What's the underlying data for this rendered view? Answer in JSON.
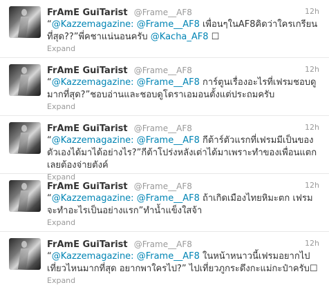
{
  "tweets": [
    {
      "fullname": "FrAmE GuiTarist",
      "username": "@Frame__AF8",
      "time": "12h",
      "q_open": "“",
      "mention": "@Kazzemagazine: @Frame__AF8",
      "body": " เพื่อนๆในAF8คิดว่าใครเกรียนที่สุด??”พี่คชาแน่นอนครับ ",
      "mention2": "@Kacha_AF8",
      "tail": " ☐",
      "expand": "Expand"
    },
    {
      "fullname": "FrAmE GuiTarist",
      "username": "@Frame__AF8",
      "time": "12h",
      "q_open": "“",
      "mention": "@Kazzemagazine: @Frame__AF8",
      "body": " การ์ตูนเรื่องอะไรที่เฟรมชอบดูมากที่สุด?”ชอบอ่านและชอบดูโดราเอมอนตั้งแต่ประถมครับ",
      "mention2": "",
      "tail": "",
      "expand": "Expand"
    },
    {
      "fullname": "FrAmE GuiTarist",
      "username": "@Frame__AF8",
      "time": "12h",
      "q_open": "“",
      "mention": "@Kazzemagazine: @Frame__AF8",
      "body": " กีต้าร์ตัวแรกที่เฟรมมีเป็นของตัวเองได้มาได้อย่างไร?”กีต้าโปร่งหลังเต่าได้มาเพราะทำของเพื่อนแตก เลยต้องจ่ายตังค์",
      "mention2": "",
      "tail": "",
      "expand": "Expand"
    },
    {
      "fullname": "FrAmE GuiTarist",
      "username": "@Frame__AF8",
      "time": "12h",
      "q_open": "“",
      "mention": "@Kazzemagazine: @Frame__AF8",
      "body": " ถ้าเกิดเมืองไทยหิมะตก เฟรมจะทำอะไรเป็นอย่างแรก”ทำน้ำแข็งใสจ้า",
      "mention2": "",
      "tail": "",
      "expand": "Expand"
    },
    {
      "fullname": "FrAmE GuiTarist",
      "username": "@Frame__AF8",
      "time": "12h",
      "q_open": "“",
      "mention": "@Kazzemagazine: @Frame__AF8",
      "body": " ในหน้าหนาวนี้เฟรมอยากไปเที่ยวไหนมากที่สุด อยากพาใครไป?” ไปเที่ยวภูกระดึงกะแม่กะป๋าครับ☐",
      "mention2": "",
      "tail": "",
      "expand": "Expand"
    }
  ]
}
